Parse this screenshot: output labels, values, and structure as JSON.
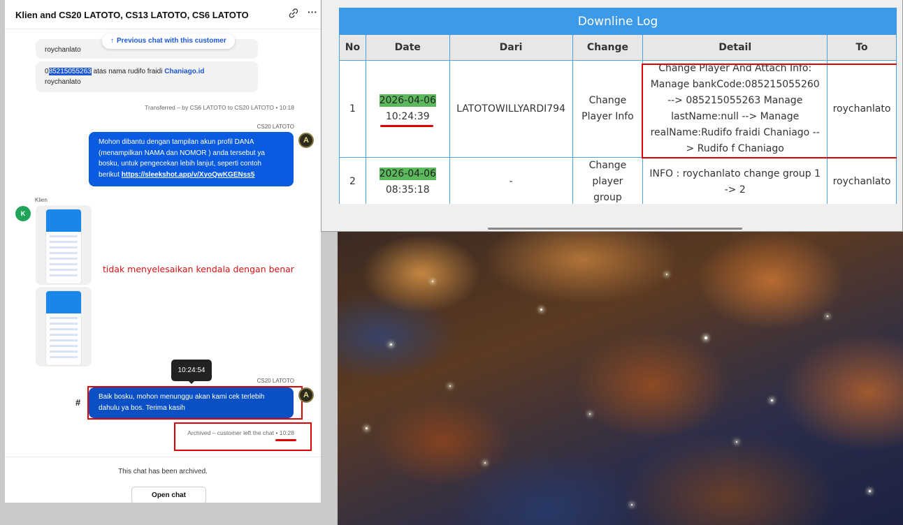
{
  "chat": {
    "title": "Klien and CS20 LATOTO, CS13 LATOTO, CS6 LATOTO",
    "prev_chat_button": "Previous chat with this customer",
    "msg1_partial": "roychanlato",
    "msg2_prefix": "0",
    "msg2_highlight": "85215055263",
    "msg2_rest": " atas nama rudifo fraidi ",
    "msg2_link": "Chaniago.id",
    "msg2_line2": "roychanlato",
    "transfer_note": "Transferred – by CS6 LATOTO to CS20 LATOTO • 10:18",
    "agent_label": "CS20 LATOTO",
    "agent_msg1_text": "Mohon dibantu dengan tampilan akun profil DANA (menampilkan NAMA dan NOMOR ) anda tersebut ya bosku, untuk pengecekan lebih lanjut, seperti contoh berikut ",
    "agent_msg1_link": "https://sleekshot.app/v/XyoQwKGENss5",
    "client_label": "Klien",
    "client_avatar": "K",
    "annotation": "tidak menyelesaikan kendala dengan benar",
    "tooltip_time": "10:24:54",
    "agent_label_2": "CS20 LATOTO",
    "hash_mark": "#",
    "agent_msg2_text": "Baik bosku, mohon menunggu akan kami cek terlebih dahulu ya bos. Terima kasih",
    "archived_note": "Archived – customer left the chat • 10:28",
    "archived_text": "This chat has been archived.",
    "open_chat_button": "Open chat",
    "agent_avatar": "A"
  },
  "downline": {
    "title": "Downline Log",
    "columns": [
      "No",
      "Date",
      "Dari",
      "Change",
      "Detail",
      "To"
    ],
    "rows": [
      {
        "no": "1",
        "date": "2026-04-06",
        "time": "10:24:39",
        "dari": "LATOTOWILLYARDI794",
        "change": "Change Player Info",
        "detail": "Change Player And Attach Info: Manage bankCode:085215055260 --> 085215055263 Manage lastName:null --> Manage realName:Rudifo fraidi Chaniago --> Rudifo f Chaniago",
        "to": "roychanlato"
      },
      {
        "no": "2",
        "date": "2026-04-06",
        "time": "08:35:18",
        "dari": "-",
        "change": "Change player group",
        "detail": "INFO : roychanlato change group 1 -> 2",
        "to": "roychanlato"
      }
    ]
  },
  "colors": {
    "accent_blue": "#0a5be0",
    "table_header_blue": "#3d9ae8",
    "highlight_green": "#5cb85c",
    "annotation_red": "#e00000"
  },
  "icons": [
    "link-icon",
    "more-icon",
    "arrow-up-icon"
  ]
}
